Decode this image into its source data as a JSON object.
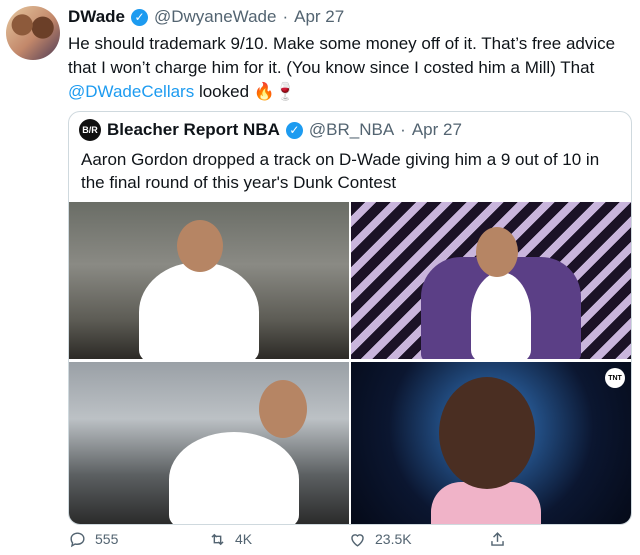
{
  "tweet": {
    "author_name": "DWade",
    "handle": "@DwyaneWade",
    "separator": "·",
    "date": "Apr 27",
    "text_before": "He should trademark 9/10. Make some money off of it. That’s free advice that I won’t charge him for it. (You know since I costed him a Mill)  That ",
    "mention": "@DWadeCellars",
    "text_after": " looked 🔥🍷"
  },
  "quoted_tweet": {
    "logo_text": "B/R",
    "author_name": "Bleacher Report NBA",
    "handle": "@BR_NBA",
    "separator": "·",
    "date": "Apr 27",
    "text": "Aaron Gordon dropped a track on D-Wade giving him a 9 out of 10 in the final round of this year's Dunk Contest",
    "broadcast_logo": "TNT"
  },
  "actions": {
    "replies": "555",
    "retweets": "4K",
    "likes": "23.5K"
  },
  "colors": {
    "accent": "#1d9bf0",
    "muted": "#536471",
    "border": "#cfd9de"
  },
  "icons": [
    "verified-badge-icon",
    "reply-icon",
    "retweet-icon",
    "like-icon",
    "share-icon"
  ]
}
